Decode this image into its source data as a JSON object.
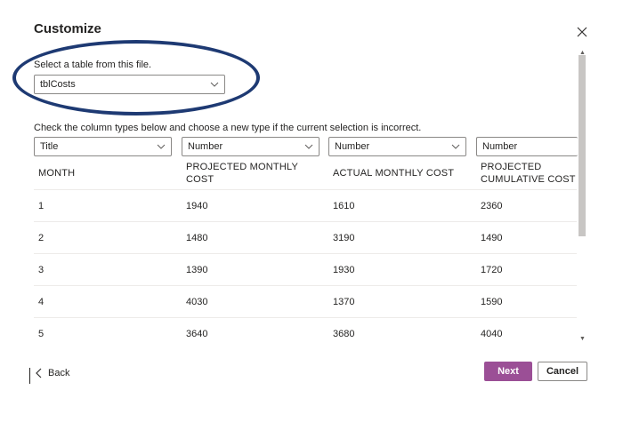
{
  "dialog": {
    "title": "Customize"
  },
  "table_picker": {
    "label": "Select a table from this file.",
    "selected": "tblCosts"
  },
  "column_types": {
    "label": "Check the column types below and choose a new type if the current selection is incorrect.",
    "selects": [
      "Title",
      "Number",
      "Number",
      "Number"
    ]
  },
  "table": {
    "headers": [
      "MONTH",
      "PROJECTED MONTHLY COST",
      "ACTUAL MONTHLY COST",
      "PROJECTED CUMULATIVE COST"
    ],
    "rows": [
      [
        "1",
        "1940",
        "1610",
        "2360"
      ],
      [
        "2",
        "1480",
        "3190",
        "1490"
      ],
      [
        "3",
        "1390",
        "1930",
        "1720"
      ],
      [
        "4",
        "4030",
        "1370",
        "1590"
      ],
      [
        "5",
        "3640",
        "3680",
        "4040"
      ]
    ]
  },
  "footer": {
    "back_label": "Back",
    "next_label": "Next",
    "cancel_label": "Cancel"
  },
  "colors": {
    "accent": "#9b4f96",
    "highlight_ellipse": "#1e3a73"
  },
  "icons": {
    "close": "close-icon",
    "chevron": "chevron-down-icon",
    "back": "chevron-left-icon"
  }
}
